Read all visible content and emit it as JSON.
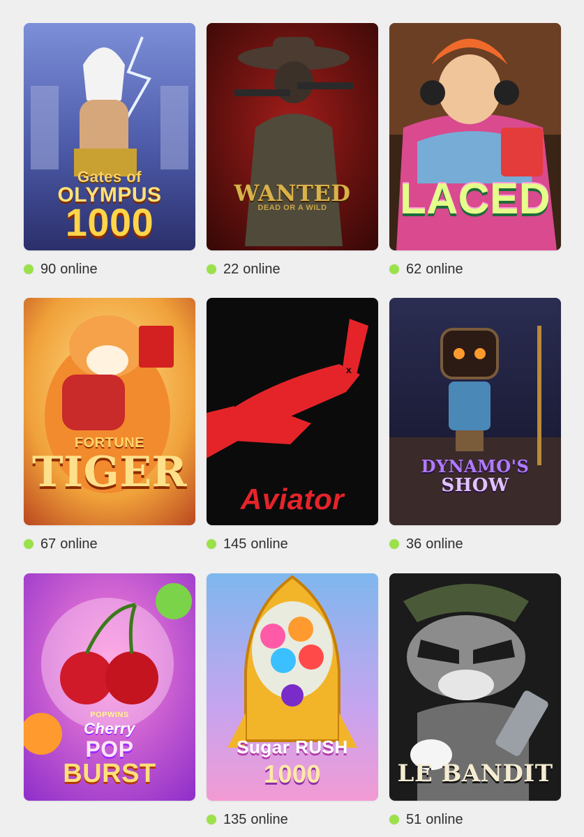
{
  "games": [
    {
      "id": "olympus",
      "logo_lines": [
        "Gates of",
        "OLYMPUS",
        "1000"
      ],
      "online_count": "90",
      "online_label": "online"
    },
    {
      "id": "wanted",
      "logo_lines": [
        "WANTED",
        "DEAD OR A WILD"
      ],
      "online_count": "22",
      "online_label": "online"
    },
    {
      "id": "laced",
      "logo_lines": [
        "LACED"
      ],
      "online_count": "62",
      "online_label": "online"
    },
    {
      "id": "tiger",
      "logo_lines": [
        "FORTUNE",
        "TIGER"
      ],
      "online_count": "67",
      "online_label": "online"
    },
    {
      "id": "aviator",
      "logo_lines": [
        "Aviator"
      ],
      "online_count": "145",
      "online_label": "online"
    },
    {
      "id": "dynamo",
      "logo_lines": [
        "DYNAMO'S",
        "SHOW"
      ],
      "online_count": "36",
      "online_label": "online"
    },
    {
      "id": "cherry",
      "logo_lines": [
        "POPWINS",
        "Cherry",
        "POP",
        "BURST"
      ],
      "online_count": "",
      "online_label": ""
    },
    {
      "id": "sugar",
      "logo_lines": [
        "Sugar RUSH",
        "1000"
      ],
      "online_count": "135",
      "online_label": "online"
    },
    {
      "id": "bandit",
      "logo_lines": [
        "LE BANDIT"
      ],
      "online_count": "51",
      "online_label": "online"
    }
  ],
  "colors": {
    "online_dot": "#9be14a",
    "background": "#efefef"
  }
}
